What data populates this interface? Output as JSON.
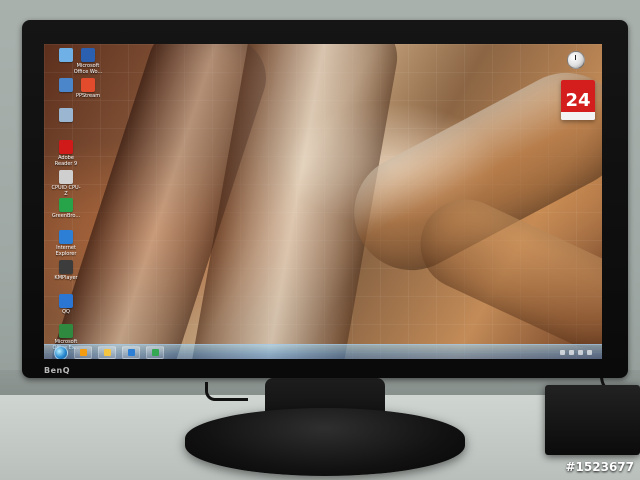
{
  "scene": {
    "brand": "BenQ",
    "watermark": "#1523677"
  },
  "desktop": {
    "icons": [
      {
        "label": "",
        "icon": "computer-icon",
        "color": "#6fb1e7"
      },
      {
        "label": "Microsoft Office Wo...",
        "icon": "word-icon",
        "color": "#2b5fb0"
      },
      {
        "label": "",
        "icon": "control-panel-icon",
        "color": "#4a86c9"
      },
      {
        "label": "PPStream",
        "icon": "ppstream-icon",
        "color": "#e24b2b"
      },
      {
        "label": "",
        "icon": "recycle-bin-icon",
        "color": "#9bb6d1"
      },
      {
        "label": "Adobe Reader 9",
        "icon": "adobe-reader-icon",
        "color": "#d01a1a"
      },
      {
        "label": "CPUID CPU-Z",
        "icon": "cpuz-icon",
        "color": "#cfcfcf"
      },
      {
        "label": "GreenBro...",
        "icon": "green-icon",
        "color": "#27a34a"
      },
      {
        "label": "Internet Explorer",
        "icon": "ie-icon",
        "color": "#2d7fd6"
      },
      {
        "label": "KMPlayer",
        "icon": "kmplayer-icon",
        "color": "#3c3c3c"
      },
      {
        "label": "QQ",
        "icon": "qq-icon",
        "color": "#2a76d2"
      },
      {
        "label": "Microsoft Office Ex...",
        "icon": "excel-icon",
        "color": "#2f8a3f"
      }
    ],
    "calendar": {
      "day": "24"
    }
  },
  "taskbar": {
    "tasks": [
      {
        "icon": "media-player-icon",
        "color": "#f39c12"
      },
      {
        "icon": "explorer-folder-icon",
        "color": "#f4c542"
      },
      {
        "icon": "app-icon",
        "color": "#2d7fd6"
      },
      {
        "icon": "app-icon",
        "color": "#34a853"
      }
    ],
    "tray_icons": [
      "keyboard-icon",
      "network-icon",
      "volume-icon",
      "security-icon"
    ]
  }
}
